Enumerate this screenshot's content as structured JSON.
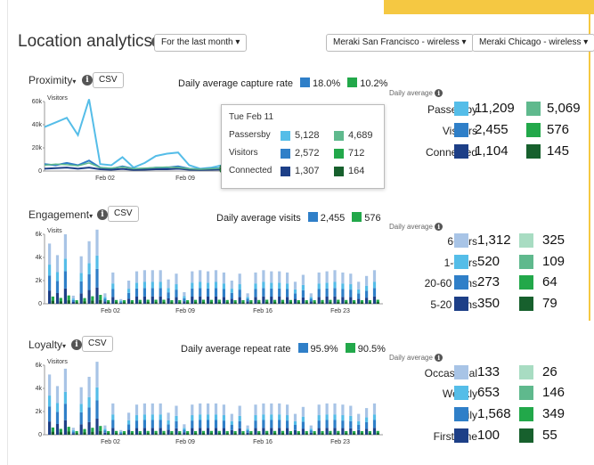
{
  "header": {
    "title": "Location analytics",
    "time_filter": "For the last month ▾",
    "network_a": "Meraki San Francisco - wireless ▾",
    "network_b": "Meraki Chicago - wireless ▾"
  },
  "colors": {
    "light_blue": "#a8c4e6",
    "sky": "#55bde8",
    "mid_blue": "#2f7fc8",
    "navy": "#1d3f87",
    "light_green": "#a8dcc2",
    "mint": "#5fb98d",
    "green": "#22a84a",
    "dark_green": "#17602d",
    "accent": "#f5c842"
  },
  "proximity": {
    "title": "Proximity",
    "csv": "CSV",
    "avg_label": "Daily average capture rate",
    "avg_a": "18.0%",
    "avg_b": "10.2%",
    "daily_avg_title": "Daily average",
    "rows": [
      {
        "label": "Passersby",
        "a": "11,209",
        "b": "5,069"
      },
      {
        "label": "Visitors",
        "a": "2,455",
        "b": "576"
      },
      {
        "label": "Connected",
        "a": "1,104",
        "b": "145"
      }
    ],
    "tooltip": {
      "date": "Tue Feb 11",
      "rows": [
        {
          "label": "Passersby",
          "a": "5,128",
          "b": "4,689"
        },
        {
          "label": "Visitors",
          "a": "2,572",
          "b": "712"
        },
        {
          "label": "Connected",
          "a": "1,307",
          "b": "164"
        }
      ]
    }
  },
  "engagement": {
    "title": "Engagement",
    "csv": "CSV",
    "avg_label": "Daily average visits",
    "avg_a": "2,455",
    "avg_b": "576",
    "daily_avg_title": "Daily average",
    "rows": [
      {
        "label": "6+ hrs",
        "a": "1,312",
        "b": "325"
      },
      {
        "label": "1-6 hrs",
        "a": "520",
        "b": "109"
      },
      {
        "label": "20-60 mins",
        "a": "273",
        "b": "64"
      },
      {
        "label": "5-20 mins",
        "a": "350",
        "b": "79"
      }
    ]
  },
  "loyalty": {
    "title": "Loyalty",
    "csv": "CSV",
    "avg_label": "Daily average repeat rate",
    "avg_a": "95.9%",
    "avg_b": "90.5%",
    "daily_avg_title": "Daily average",
    "rows": [
      {
        "label": "Occasional",
        "a": "133",
        "b": "26"
      },
      {
        "label": "Weekly",
        "a": "653",
        "b": "146"
      },
      {
        "label": "Daily",
        "a": "1,568",
        "b": "349"
      },
      {
        "label": "First time",
        "a": "100",
        "b": "55"
      }
    ]
  },
  "chart_data": [
    {
      "type": "line",
      "ylabel": "Visitors",
      "ylim": [
        0,
        60000
      ],
      "y_ticks": [
        "0",
        "20k",
        "40k",
        "60k"
      ],
      "x_ticks": [
        "Feb 02",
        "Feb 09"
      ],
      "series": [
        {
          "values": [
            38000,
            42000,
            46000,
            31000,
            62000,
            6000,
            5000,
            12000,
            3000,
            7000,
            13000,
            15000,
            16000,
            5000,
            2000,
            3000,
            5128
          ]
        },
        {
          "values": [
            6000,
            5000,
            7000,
            5000,
            9000,
            3000,
            2000,
            4000,
            2000,
            2000,
            3000,
            3000,
            4000,
            2000,
            1500,
            2000,
            2572
          ]
        },
        {
          "values": [
            2000,
            2500,
            3000,
            2000,
            3000,
            1500,
            1200,
            1800,
            1000,
            1200,
            1500,
            1500,
            2000,
            1200,
            1000,
            1200,
            1307
          ]
        }
      ]
    },
    {
      "type": "bar",
      "ylabel": "Visits",
      "ylim": [
        0,
        6000
      ],
      "y_ticks": [
        "0",
        "2k",
        "4k",
        "6k"
      ],
      "x_ticks": [
        "Feb 02",
        "Feb 09",
        "Feb 16",
        "Feb 23"
      ],
      "series": [
        {
          "values": [
            5200,
            4200,
            6000,
            700,
            4100,
            5400,
            6400,
            900,
            2700,
            400,
            2000,
            2800,
            2900,
            2900,
            2900,
            2100,
            2600,
            1000,
            2800,
            2900,
            2800,
            2900,
            2700,
            2000,
            2600,
            900,
            2700,
            2900,
            2800,
            2800,
            2700,
            1900,
            2500,
            900,
            2700,
            2800,
            2900,
            2700,
            2600,
            1900,
            2400,
            2900
          ]
        }
      ]
    },
    {
      "type": "bar",
      "ylabel": "Visitors",
      "ylim": [
        0,
        6000
      ],
      "y_ticks": [
        "0",
        "2k",
        "4k",
        "6k"
      ],
      "x_ticks": [
        "Feb 02",
        "Feb 09",
        "Feb 16",
        "Feb 23"
      ],
      "series": [
        {
          "values": [
            5200,
            4200,
            5700,
            600,
            4100,
            5000,
            6300,
            800,
            2700,
            400,
            1900,
            2600,
            2700,
            2700,
            2700,
            1900,
            2500,
            900,
            2600,
            2700,
            2700,
            2700,
            2600,
            1800,
            2500,
            800,
            2600,
            2700,
            2700,
            2700,
            2600,
            1800,
            2400,
            800,
            2600,
            2700,
            2700,
            2600,
            2500,
            1800,
            2300,
            2700
          ]
        }
      ]
    }
  ]
}
